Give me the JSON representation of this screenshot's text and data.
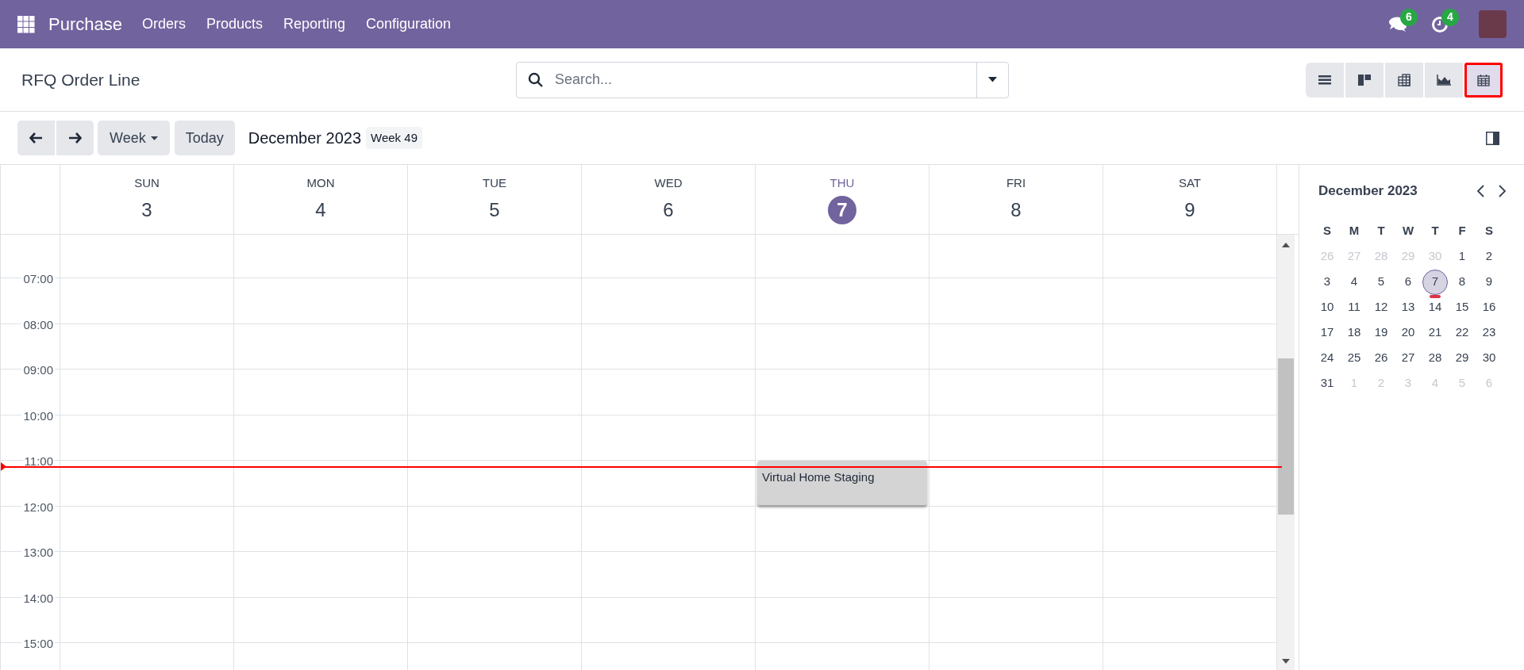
{
  "navbar": {
    "app_name": "Purchase",
    "menu": [
      "Orders",
      "Products",
      "Reporting",
      "Configuration"
    ],
    "messages_count": "6",
    "activities_count": "4"
  },
  "control_panel": {
    "title": "RFQ Order Line",
    "search": {
      "placeholder": "Search..."
    },
    "views": [
      {
        "kind": "list",
        "selected": false
      },
      {
        "kind": "kanban",
        "selected": false
      },
      {
        "kind": "pivot",
        "selected": false
      },
      {
        "kind": "graph",
        "selected": false
      },
      {
        "kind": "calendar",
        "selected": true
      }
    ]
  },
  "toolbar": {
    "range": "Week",
    "today": "Today",
    "period": "December 2023",
    "week": "Week 49"
  },
  "days": [
    {
      "weekday": "SUN",
      "date": "3",
      "today": false
    },
    {
      "weekday": "MON",
      "date": "4",
      "today": false
    },
    {
      "weekday": "TUE",
      "date": "5",
      "today": false
    },
    {
      "weekday": "WED",
      "date": "6",
      "today": false
    },
    {
      "weekday": "THU",
      "date": "7",
      "today": true,
      "events": [
        {
          "title": "Virtual Home Staging"
        }
      ]
    },
    {
      "weekday": "FRI",
      "date": "8",
      "today": false
    },
    {
      "weekday": "SAT",
      "date": "9",
      "today": false
    }
  ],
  "hours": [
    "07:00",
    "08:00",
    "09:00",
    "10:00",
    "11:00",
    "12:00",
    "13:00",
    "14:00",
    "15:00"
  ],
  "mini_calendar": {
    "title": "December 2023",
    "weekdays": [
      "S",
      "M",
      "T",
      "W",
      "T",
      "F",
      "S"
    ],
    "weeks": [
      [
        {
          "day": "26",
          "muted": true,
          "today": false
        },
        {
          "day": "27",
          "muted": true,
          "today": false
        },
        {
          "day": "28",
          "muted": true,
          "today": false
        },
        {
          "day": "29",
          "muted": true,
          "today": false
        },
        {
          "day": "30",
          "muted": true,
          "today": false
        },
        {
          "day": "1",
          "muted": false,
          "today": false
        },
        {
          "day": "2",
          "muted": false,
          "today": false
        }
      ],
      [
        {
          "day": "3",
          "muted": false,
          "today": false
        },
        {
          "day": "4",
          "muted": false,
          "today": false
        },
        {
          "day": "5",
          "muted": false,
          "today": false
        },
        {
          "day": "6",
          "muted": false,
          "today": false
        },
        {
          "day": "7",
          "muted": false,
          "today": true
        },
        {
          "day": "8",
          "muted": false,
          "today": false
        },
        {
          "day": "9",
          "muted": false,
          "today": false
        }
      ],
      [
        {
          "day": "10",
          "muted": false,
          "today": false
        },
        {
          "day": "11",
          "muted": false,
          "today": false
        },
        {
          "day": "12",
          "muted": false,
          "today": false
        },
        {
          "day": "13",
          "muted": false,
          "today": false
        },
        {
          "day": "14",
          "muted": false,
          "today": false
        },
        {
          "day": "15",
          "muted": false,
          "today": false
        },
        {
          "day": "16",
          "muted": false,
          "today": false
        }
      ],
      [
        {
          "day": "17",
          "muted": false,
          "today": false
        },
        {
          "day": "18",
          "muted": false,
          "today": false
        },
        {
          "day": "19",
          "muted": false,
          "today": false
        },
        {
          "day": "20",
          "muted": false,
          "today": false
        },
        {
          "day": "21",
          "muted": false,
          "today": false
        },
        {
          "day": "22",
          "muted": false,
          "today": false
        },
        {
          "day": "23",
          "muted": false,
          "today": false
        }
      ],
      [
        {
          "day": "24",
          "muted": false,
          "today": false
        },
        {
          "day": "25",
          "muted": false,
          "today": false
        },
        {
          "day": "26",
          "muted": false,
          "today": false
        },
        {
          "day": "27",
          "muted": false,
          "today": false
        },
        {
          "day": "28",
          "muted": false,
          "today": false
        },
        {
          "day": "29",
          "muted": false,
          "today": false
        },
        {
          "day": "30",
          "muted": false,
          "today": false
        }
      ],
      [
        {
          "day": "31",
          "muted": false,
          "today": false
        },
        {
          "day": "1",
          "muted": true,
          "today": false
        },
        {
          "day": "2",
          "muted": true,
          "today": false
        },
        {
          "day": "3",
          "muted": true,
          "today": false
        },
        {
          "day": "4",
          "muted": true,
          "today": false
        },
        {
          "day": "5",
          "muted": true,
          "today": false
        },
        {
          "day": "6",
          "muted": true,
          "today": false
        }
      ]
    ]
  }
}
